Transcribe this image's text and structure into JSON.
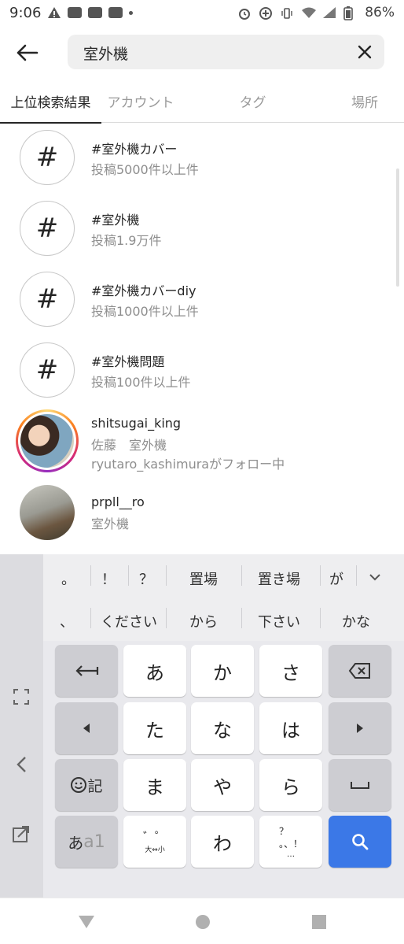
{
  "status_bar": {
    "time": "9:06",
    "battery": "86%"
  },
  "search": {
    "query": "室外機"
  },
  "tabs": [
    {
      "label": "上位検索結果",
      "active": true
    },
    {
      "label": "アカウント",
      "active": false
    },
    {
      "label": "タグ",
      "active": false
    },
    {
      "label": "場所",
      "active": false
    }
  ],
  "results": [
    {
      "type": "hashtag",
      "title": "#室外機カバー",
      "subtitle": "投稿5000件以上件"
    },
    {
      "type": "hashtag",
      "title": "#室外機",
      "subtitle": "投稿1.9万件"
    },
    {
      "type": "hashtag",
      "title": "#室外機カバーdiy",
      "subtitle": "投稿1000件以上件"
    },
    {
      "type": "hashtag",
      "title": "#室外機問題",
      "subtitle": "投稿100件以上件"
    },
    {
      "type": "account",
      "title": "shitsugai_king",
      "subtitle": "佐藤　室外機",
      "note": "ryutaro_kashimuraがフォロー中"
    },
    {
      "type": "account",
      "title": "prpll__ro",
      "subtitle": "室外機"
    }
  ],
  "hash_symbol": "#",
  "keyboard": {
    "suggestions_row1": [
      "。",
      "！",
      "？",
      "置場",
      "置き場",
      "が"
    ],
    "suggestions_row2": [
      "、",
      "ください",
      "から",
      "下さい",
      "かな"
    ],
    "keys": {
      "a": "あ",
      "ka": "か",
      "sa": "さ",
      "ta": "た",
      "na": "な",
      "ha": "は",
      "ma": "ま",
      "ya": "や",
      "ra": "ら",
      "wa": "わ",
      "emoji_label": "記",
      "mode_label_a": "あ",
      "mode_label_b": "a1",
      "dakuten_label": "大⇔小",
      "punct_label": "…"
    }
  },
  "colors": {
    "accent_blue": "#3b78e7",
    "text_primary": "#262626",
    "text_secondary": "#8e8e8e"
  }
}
